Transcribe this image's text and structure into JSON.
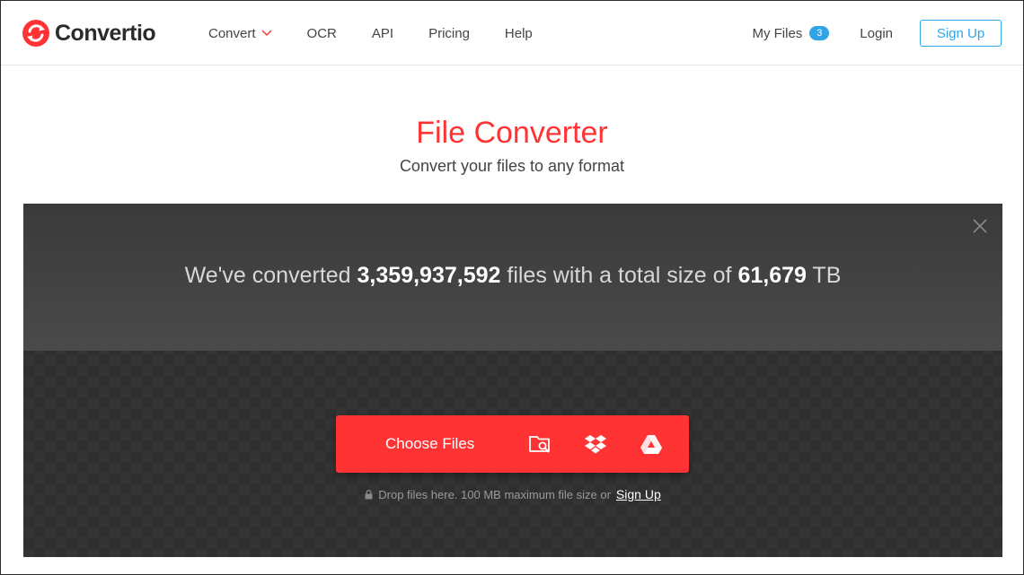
{
  "header": {
    "logo_text": "Convertio",
    "nav": [
      {
        "label": "Convert"
      },
      {
        "label": "OCR"
      },
      {
        "label": "API"
      },
      {
        "label": "Pricing"
      },
      {
        "label": "Help"
      }
    ],
    "my_files_label": "My Files",
    "my_files_count": "3",
    "login_label": "Login",
    "signup_label": "Sign Up"
  },
  "hero": {
    "title": "File Converter",
    "subtitle": "Convert your files to any format"
  },
  "stats": {
    "prefix": "We've converted",
    "files_count": "3,359,937,592",
    "middle": "files with a total size of",
    "total_size": "61,679",
    "unit": "TB"
  },
  "upload": {
    "choose_label": "Choose Files",
    "icons": [
      "folder-search-icon",
      "dropbox-icon",
      "google-drive-icon"
    ],
    "hint": "Drop files here. 100 MB maximum file size or",
    "hint_link": "Sign Up"
  },
  "colors": {
    "brand_red": "#ff3333",
    "accent_blue": "#2fa4e7",
    "panel_dark": "#343434"
  }
}
